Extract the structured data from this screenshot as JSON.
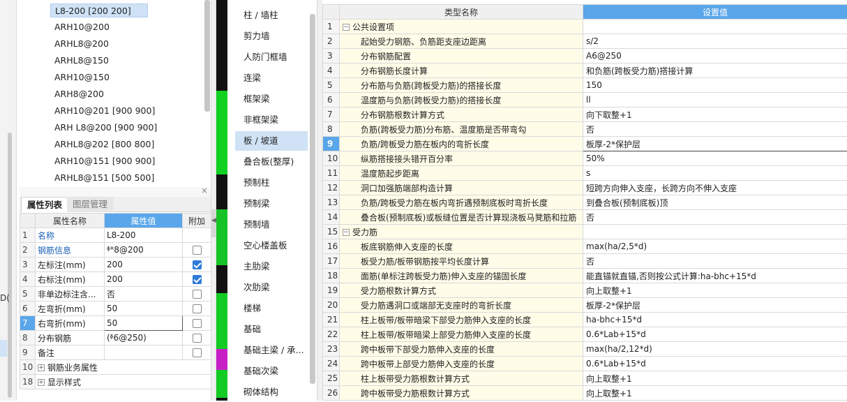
{
  "left_fragment": "D(",
  "tree": {
    "items": [
      "L8-200 [200 200]",
      "ARH10@200",
      "ARHL8@200",
      "ARHL8@150",
      "ARH10@150",
      "ARH8@200",
      "ARH10@201 [900 900]",
      "ARH L8@200 [900 900]",
      "ARHL8@202 [800 800]",
      "ARH10@151 [900 900]",
      "ARHL8@151 [500 500]"
    ]
  },
  "prop_panel": {
    "close_glyph": "×",
    "tabs": [
      "属性列表",
      "图层管理"
    ],
    "headers": [
      "属性名称",
      "属性值",
      "附加"
    ],
    "rows": [
      {
        "num": "1",
        "name": "名称",
        "value": "L8-200",
        "check": null
      },
      {
        "num": "2",
        "name": "钢筋信息",
        "value": "ᶲᴿ8@200",
        "check": false
      },
      {
        "num": "3",
        "name": "左标注(mm)",
        "value": "200",
        "check": true
      },
      {
        "num": "4",
        "name": "右标注(mm)",
        "value": "200",
        "check": true
      },
      {
        "num": "5",
        "name": "非单边标注含...",
        "value": "否",
        "check": false
      },
      {
        "num": "6",
        "name": "左弯折(mm)",
        "value": "50",
        "check": false
      },
      {
        "num": "7",
        "name": "右弯折(mm)",
        "value": "50",
        "check": false
      },
      {
        "num": "8",
        "name": "分布钢筋",
        "value": "(ᶲ6@250)",
        "check": false
      },
      {
        "num": "9",
        "name": "备注",
        "value": "",
        "check": false
      },
      {
        "num": "10",
        "name": "钢筋业务属性",
        "value": "",
        "check": null
      },
      {
        "num": "18",
        "name": "显示样式",
        "value": "",
        "check": null
      }
    ]
  },
  "categories": {
    "items": [
      "柱 / 墙柱",
      "剪力墙",
      "人防门框墙",
      "连梁",
      "框架梁",
      "非框架梁",
      "板 / 坡道",
      "叠合板(整厚)",
      "预制柱",
      "预制梁",
      "预制墙",
      "空心楼盖板",
      "主肋梁",
      "次肋梁",
      "楼梯",
      "基础",
      "基础主梁 / 承...",
      "基础次梁",
      "砌体结构"
    ]
  },
  "settings": {
    "headers": {
      "name": "类型名称",
      "value": "设置值"
    },
    "rows": [
      {
        "num": "1",
        "name": "公共设置项",
        "value": "",
        "group": true
      },
      {
        "num": "2",
        "name": "起始受力钢筋、负筋距支座边距离",
        "value": "s/2"
      },
      {
        "num": "3",
        "name": "分布钢筋配置",
        "value": "A6@250"
      },
      {
        "num": "4",
        "name": "分布钢筋长度计算",
        "value": "和负筋(跨板受力筋)搭接计算"
      },
      {
        "num": "5",
        "name": "分布筋与负筋(跨板受力筋)的搭接长度",
        "value": "150"
      },
      {
        "num": "6",
        "name": "温度筋与负筋(跨板受力筋)的搭接长度",
        "value": "ll"
      },
      {
        "num": "7",
        "name": "分布钢筋根数计算方式",
        "value": "向下取整+1"
      },
      {
        "num": "8",
        "name": "负筋(跨板受力筋)分布筋、温度筋是否带弯勾",
        "value": "否"
      },
      {
        "num": "9",
        "name": "负筋/跨板受力筋在板内的弯折长度",
        "value": "板厚-2*保护层"
      },
      {
        "num": "10",
        "name": "纵筋搭接接头错开百分率",
        "value": "50%"
      },
      {
        "num": "11",
        "name": "温度筋起步距离",
        "value": "s"
      },
      {
        "num": "12",
        "name": "洞口加强筋端部构造计算",
        "value": "短跨方向伸入支座，长跨方向不伸入支座"
      },
      {
        "num": "13",
        "name": "负筋/跨板受力筋在板内弯折遇预制底板时弯折长度",
        "value": "到叠合板(预制底板)顶"
      },
      {
        "num": "14",
        "name": "叠合板(预制底板)或板缝位置是否计算现浇板马凳筋和拉筋",
        "value": "否"
      },
      {
        "num": "15",
        "name": "受力筋",
        "value": "",
        "group": true
      },
      {
        "num": "16",
        "name": "板底钢筋伸入支座的长度",
        "value": "max(ha/2,5*d)"
      },
      {
        "num": "17",
        "name": "板受力筋/板带钢筋按平均长度计算",
        "value": "否"
      },
      {
        "num": "18",
        "name": "面筋(单标注跨板受力筋)伸入支座的锚固长度",
        "value": "能直锚就直锚,否则按公式计算:ha-bhc+15*d"
      },
      {
        "num": "19",
        "name": "受力筋根数计算方式",
        "value": "向上取整+1"
      },
      {
        "num": "20",
        "name": "受力筋遇洞口或端部无支座时的弯折长度",
        "value": "板厚-2*保护层"
      },
      {
        "num": "21",
        "name": "柱上板带/板带暗梁下部受力筋伸入支座的长度",
        "value": "ha-bhc+15*d"
      },
      {
        "num": "22",
        "name": "柱上板带/板带暗梁上部受力筋伸入支座的长度",
        "value": "0.6*Lab+15*d"
      },
      {
        "num": "23",
        "name": "跨中板带下部受力筋伸入支座的长度",
        "value": "max(ha/2,12*d)"
      },
      {
        "num": "24",
        "name": "跨中板带上部受力筋伸入支座的长度",
        "value": "0.6*Lab+15*d"
      },
      {
        "num": "25",
        "name": "柱上板带受力筋根数计算方式",
        "value": "向上取整+1"
      },
      {
        "num": "26",
        "name": "跨中板带受力筋根数计算方式",
        "value": "向上取整+1"
      }
    ]
  },
  "colors": {
    "header_accent": "#5aa6ea",
    "selection": "#cfe2f6",
    "name_cell_bg": "#fffce8"
  }
}
